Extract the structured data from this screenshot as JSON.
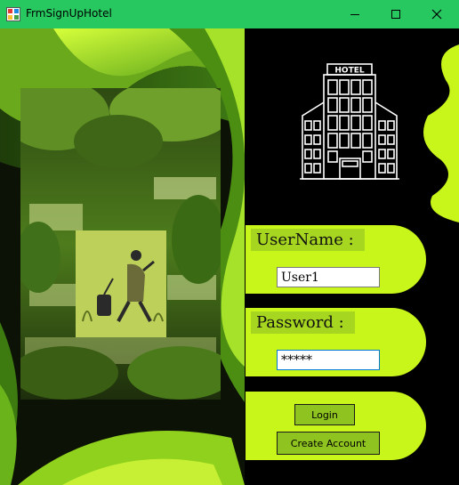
{
  "window": {
    "title": "FrmSignUpHotel",
    "controls": {
      "minimize": "minimize",
      "maximize": "maximize",
      "close": "close"
    }
  },
  "hotel_sign": {
    "text": "HOTEL"
  },
  "form": {
    "username_label": "UserName :",
    "username_value": "User1",
    "password_label": "Password :",
    "password_value": "*****",
    "login_label": "Login",
    "create_account_label": "Create Account"
  },
  "colors": {
    "titlebar": "#26c85f",
    "panel": "#c8f51a",
    "label_bg": "#a6d61f",
    "button": "#8fc31f",
    "background": "#000000"
  }
}
